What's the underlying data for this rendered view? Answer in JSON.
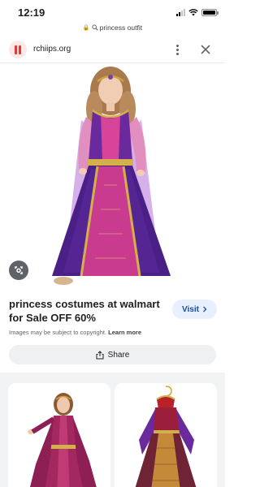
{
  "status_bar": {
    "time": "12:19"
  },
  "url_bar": {
    "text": "princess outfit",
    "search_icon": "search-icon",
    "lock_icon": "lock-icon"
  },
  "header": {
    "site_name": "rchiips.org",
    "favicon": "site-favicon-icon",
    "more_icon": "more-vert-icon",
    "close_icon": "close-icon"
  },
  "image": {
    "alt": "princess costume",
    "lens_icon": "lens-icon"
  },
  "result": {
    "title": "princess costumes at walmart for Sale OFF 60%",
    "visit_label": "Visit",
    "copyright_text": "Images may be subject to copyright.",
    "learn_more": "Learn more",
    "share_label": "Share"
  },
  "colors": {
    "accent": "#1a4a9e",
    "visit_bg": "#e8f0fe",
    "favicon": "#e53935",
    "section_bg": "#f1f3f4"
  }
}
